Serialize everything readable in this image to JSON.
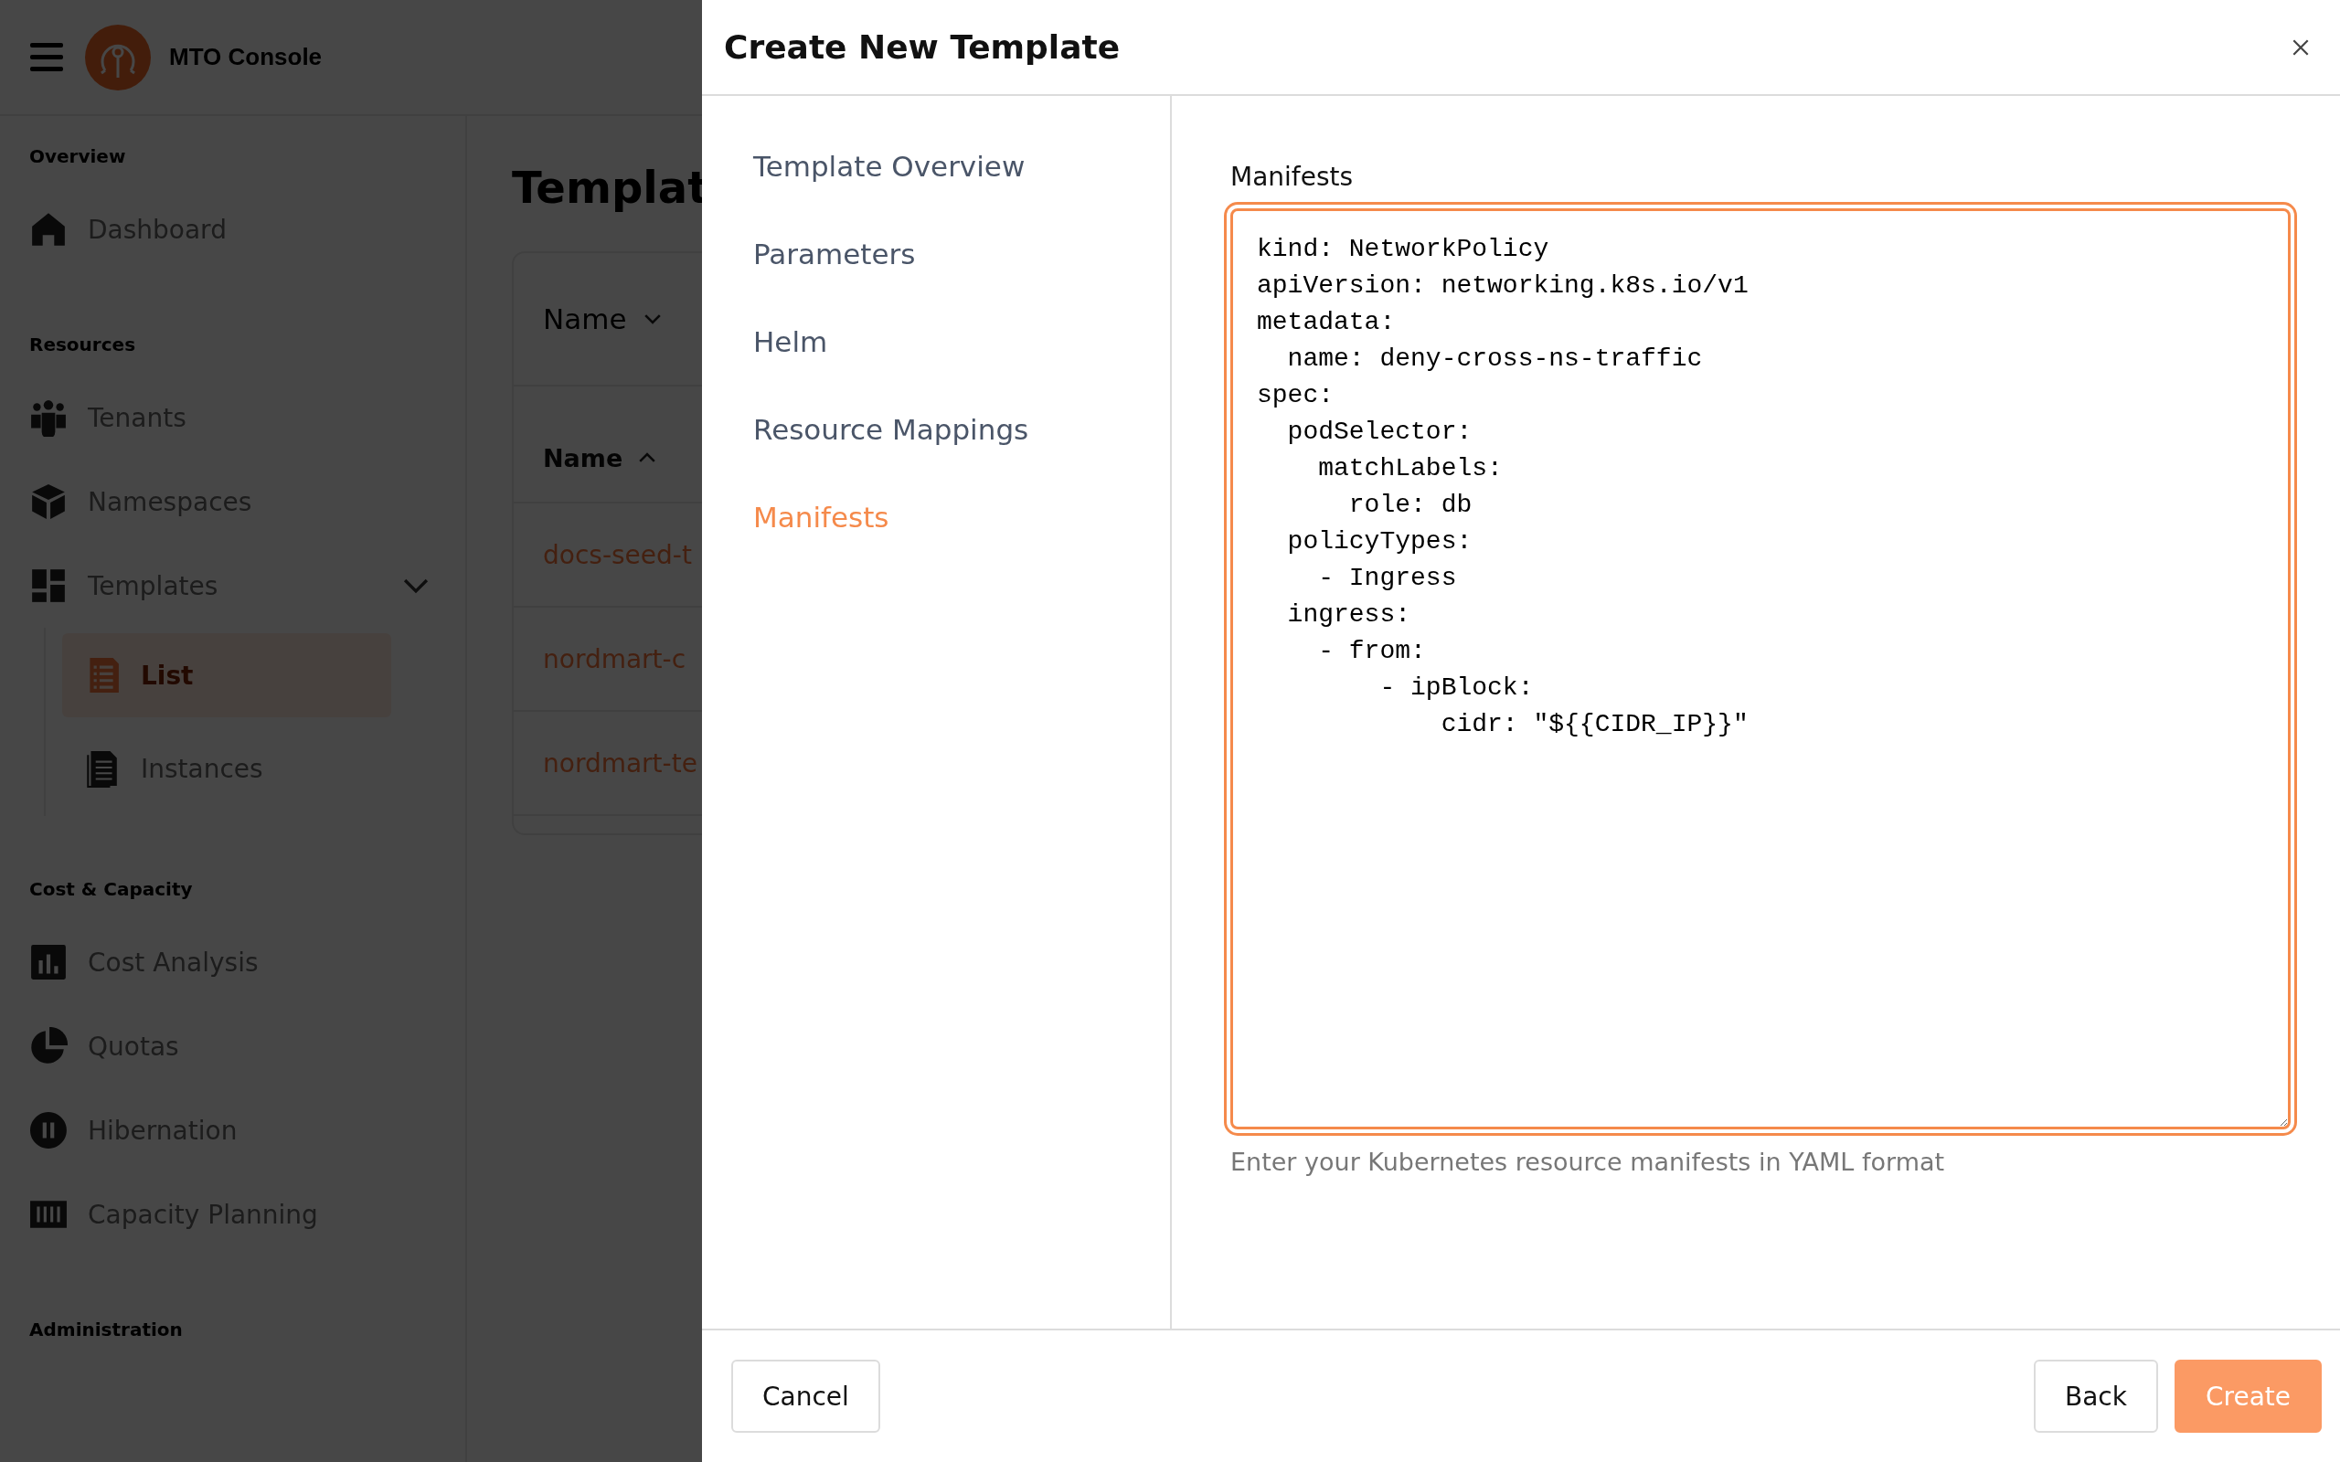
{
  "app": {
    "title": "MTO Console"
  },
  "sidebar": {
    "sections": [
      {
        "label": "Overview",
        "items": [
          {
            "label": "Dashboard",
            "selected": false
          }
        ]
      },
      {
        "label": "Resources",
        "items": [
          {
            "label": "Tenants",
            "selected": false
          },
          {
            "label": "Namespaces",
            "selected": false
          },
          {
            "label": "Templates",
            "selected": false,
            "expanded": true,
            "children": [
              {
                "label": "List",
                "selected": true
              },
              {
                "label": "Instances",
                "selected": false
              }
            ]
          }
        ]
      },
      {
        "label": "Cost & Capacity",
        "items": [
          {
            "label": "Cost Analysis",
            "selected": false
          },
          {
            "label": "Quotas",
            "selected": false
          },
          {
            "label": "Hibernation",
            "selected": false
          },
          {
            "label": "Capacity Planning",
            "selected": false
          }
        ]
      },
      {
        "label": "Administration"
      }
    ]
  },
  "page": {
    "title": "Templat",
    "filter": {
      "label": "Name"
    },
    "table": {
      "columns": [
        {
          "label": "Name",
          "sorted_ascending": true
        }
      ],
      "rows": [
        {
          "name": "docs-seed-t"
        },
        {
          "name": "nordmart-c"
        },
        {
          "name": "nordmart-te"
        }
      ]
    }
  },
  "dialog": {
    "title": "Create New Template",
    "steps": [
      {
        "label": "Template Overview",
        "selected": false
      },
      {
        "label": "Parameters",
        "selected": false
      },
      {
        "label": "Helm",
        "selected": false
      },
      {
        "label": "Resource Mappings",
        "selected": false
      },
      {
        "label": "Manifests",
        "selected": true
      }
    ],
    "field": {
      "label": "Manifests",
      "value": "kind: NetworkPolicy\napiVersion: networking.k8s.io/v1\nmetadata:\n  name: deny-cross-ns-traffic\nspec:\n  podSelector:\n    matchLabels:\n      role: db\n  policyTypes:\n    - Ingress\n  ingress:\n    - from:\n        - ipBlock:\n            cidr: \"${{CIDR_IP}}\"",
      "focused": true,
      "help": "Enter your Kubernetes resource manifests in YAML format"
    },
    "buttons": [
      {
        "label": "Cancel",
        "kind": "secondary"
      },
      {
        "label": "Back",
        "kind": "secondary"
      },
      {
        "label": "Create",
        "kind": "primary"
      }
    ]
  }
}
